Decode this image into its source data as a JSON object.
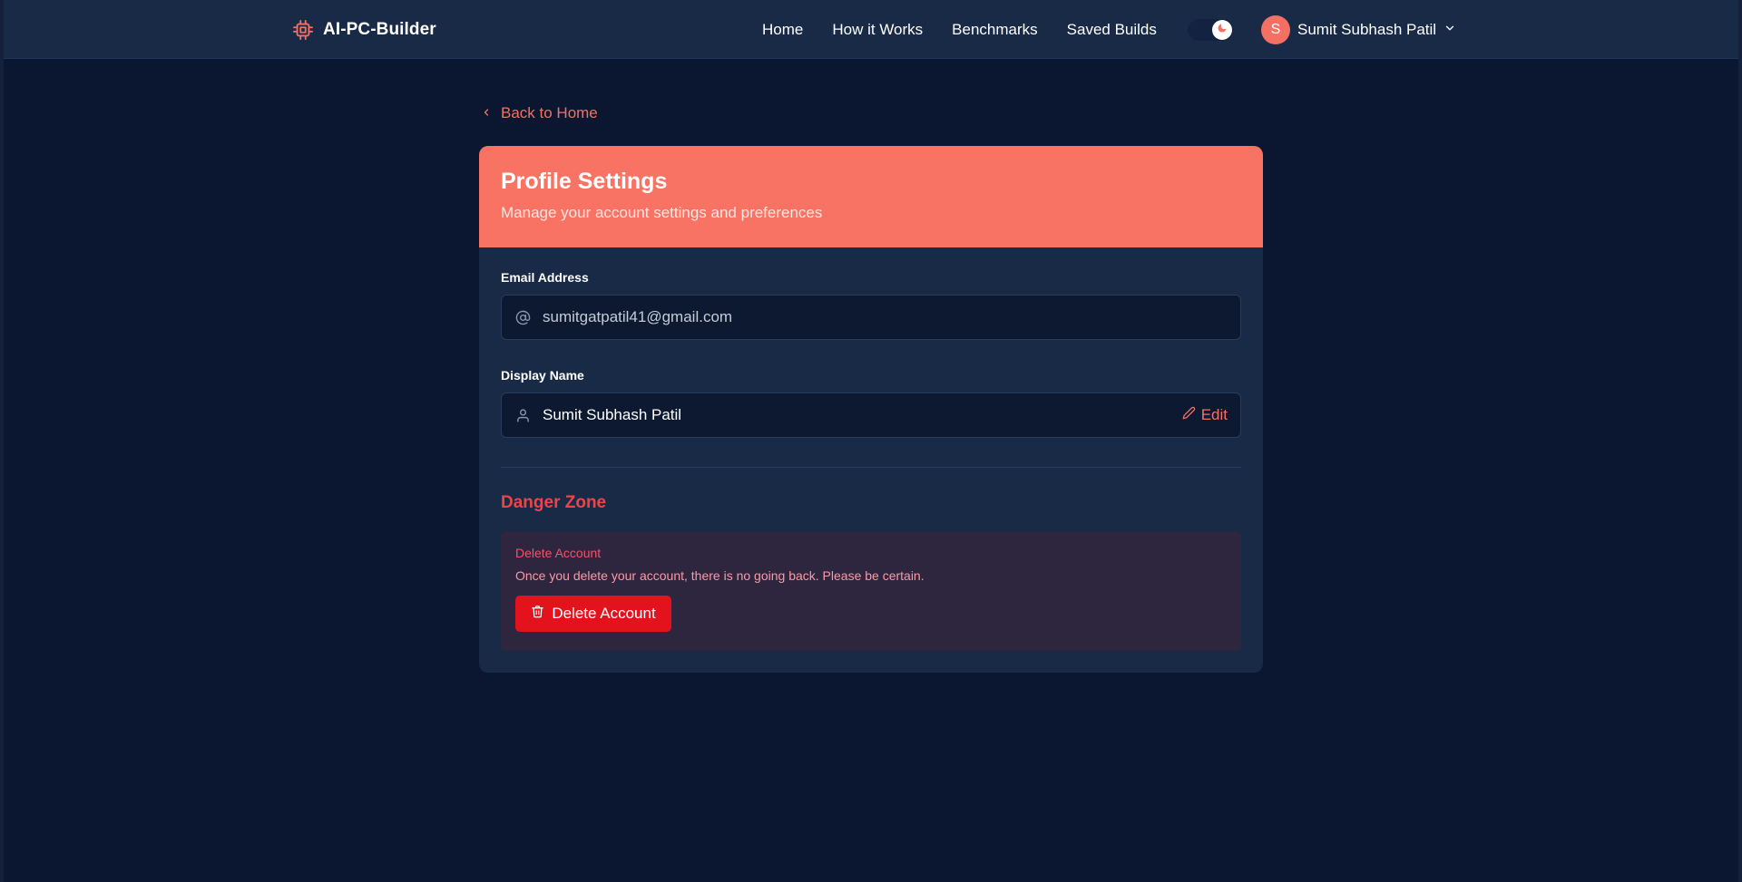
{
  "brand": {
    "name": "AI-PC-Builder",
    "icon": "cpu-icon"
  },
  "nav": {
    "links": [
      "Home",
      "How it Works",
      "Benchmarks",
      "Saved Builds"
    ],
    "theme_toggle_icon": "moon-icon",
    "user": {
      "avatar_initial": "S",
      "name": "Sumit Subhash Patil"
    }
  },
  "back_link": {
    "label": "Back to Home"
  },
  "profile": {
    "title": "Profile Settings",
    "subtitle": "Manage your account settings and preferences",
    "email": {
      "label": "Email Address",
      "value": "sumitgatpatil41@gmail.com"
    },
    "display_name": {
      "label": "Display Name",
      "value": "Sumit Subhash Patil",
      "edit_label": "Edit"
    }
  },
  "danger_zone": {
    "title": "Danger Zone",
    "heading": "Delete Account",
    "text": "Once you delete your account, there is no going back. Please be certain.",
    "button_label": "Delete Account"
  },
  "colors": {
    "background": "#0b1730",
    "navbar": "#192a47",
    "accent": "#f47063",
    "danger": "#e3121d"
  }
}
